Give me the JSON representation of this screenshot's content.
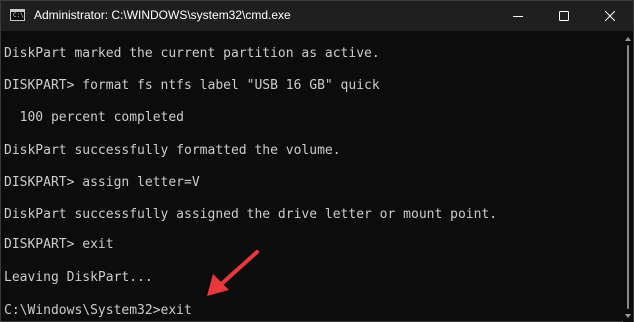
{
  "window": {
    "title": "Administrator: C:\\WINDOWS\\system32\\cmd.exe",
    "icon": "cmd-icon",
    "controls": [
      "minimize-icon",
      "maximize-icon",
      "close-icon"
    ]
  },
  "console": {
    "lines": [
      "DiskPart marked the current partition as active.",
      "",
      "DISKPART> format fs ntfs label \"USB 16 GB\" quick",
      "",
      "  100 percent completed",
      "",
      "DiskPart successfully formatted the volume.",
      "",
      "DISKPART> assign letter=V",
      "",
      "DiskPart successfully assigned the drive letter or mount point.",
      "",
      "DISKPART> exit",
      "",
      "Leaving DiskPart...",
      "",
      "C:\\Windows\\System32>exit"
    ]
  },
  "colors": {
    "background": "#0c0c0c",
    "text": "#cccccc",
    "titlebar": "#1f1f1f",
    "annotation_arrow": "#e8383d"
  }
}
